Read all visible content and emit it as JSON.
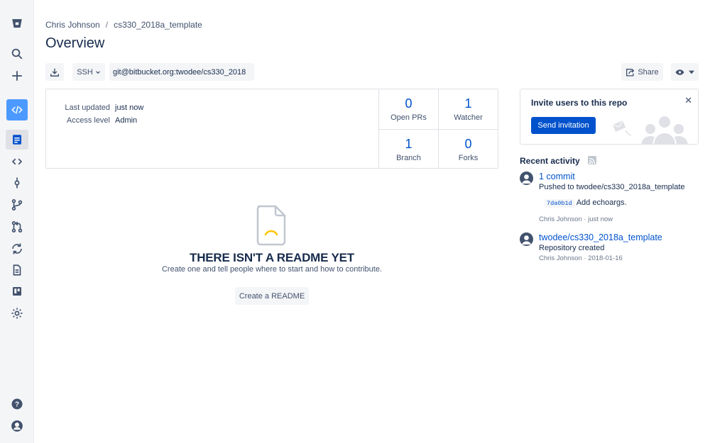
{
  "breadcrumb": {
    "owner": "Chris Johnson",
    "separator": "/",
    "repo": "cs330_2018a_template"
  },
  "page_title": "Overview",
  "toolbar": {
    "protocol": "SSH",
    "clone_url": "git@bitbucket.org:twodee/cs330_2018",
    "share_label": "Share"
  },
  "summary": {
    "last_updated_label": "Last updated",
    "last_updated_value": "just now",
    "access_level_label": "Access level",
    "access_level_value": "Admin",
    "stats": [
      {
        "value": "0",
        "label": "Open PRs"
      },
      {
        "value": "1",
        "label": "Watcher"
      },
      {
        "value": "1",
        "label": "Branch"
      },
      {
        "value": "0",
        "label": "Forks"
      }
    ]
  },
  "readme": {
    "title": "THERE ISN'T A README YET",
    "subtitle": "Create one and tell people where to start and how to contribute.",
    "button": "Create a README"
  },
  "invite": {
    "title": "Invite users to this repo",
    "button": "Send invitation",
    "close": "✕"
  },
  "recent_activity": {
    "title": "Recent activity",
    "items": [
      {
        "link": "1 commit",
        "desc": "Pushed to twodee/cs330_2018a_template",
        "hash": "7da0b1d",
        "message": "Add echoargs.",
        "by": "Chris Johnson · just now"
      },
      {
        "link": "twodee/cs330_2018a_template",
        "desc": "Repository created",
        "by": "Chris Johnson · 2018-01-16"
      }
    ]
  },
  "colors": {
    "primary": "#0052cc",
    "sidebar_bg": "#f4f5f7",
    "active_nav": "#4c9aff",
    "text": "#172b4d"
  }
}
